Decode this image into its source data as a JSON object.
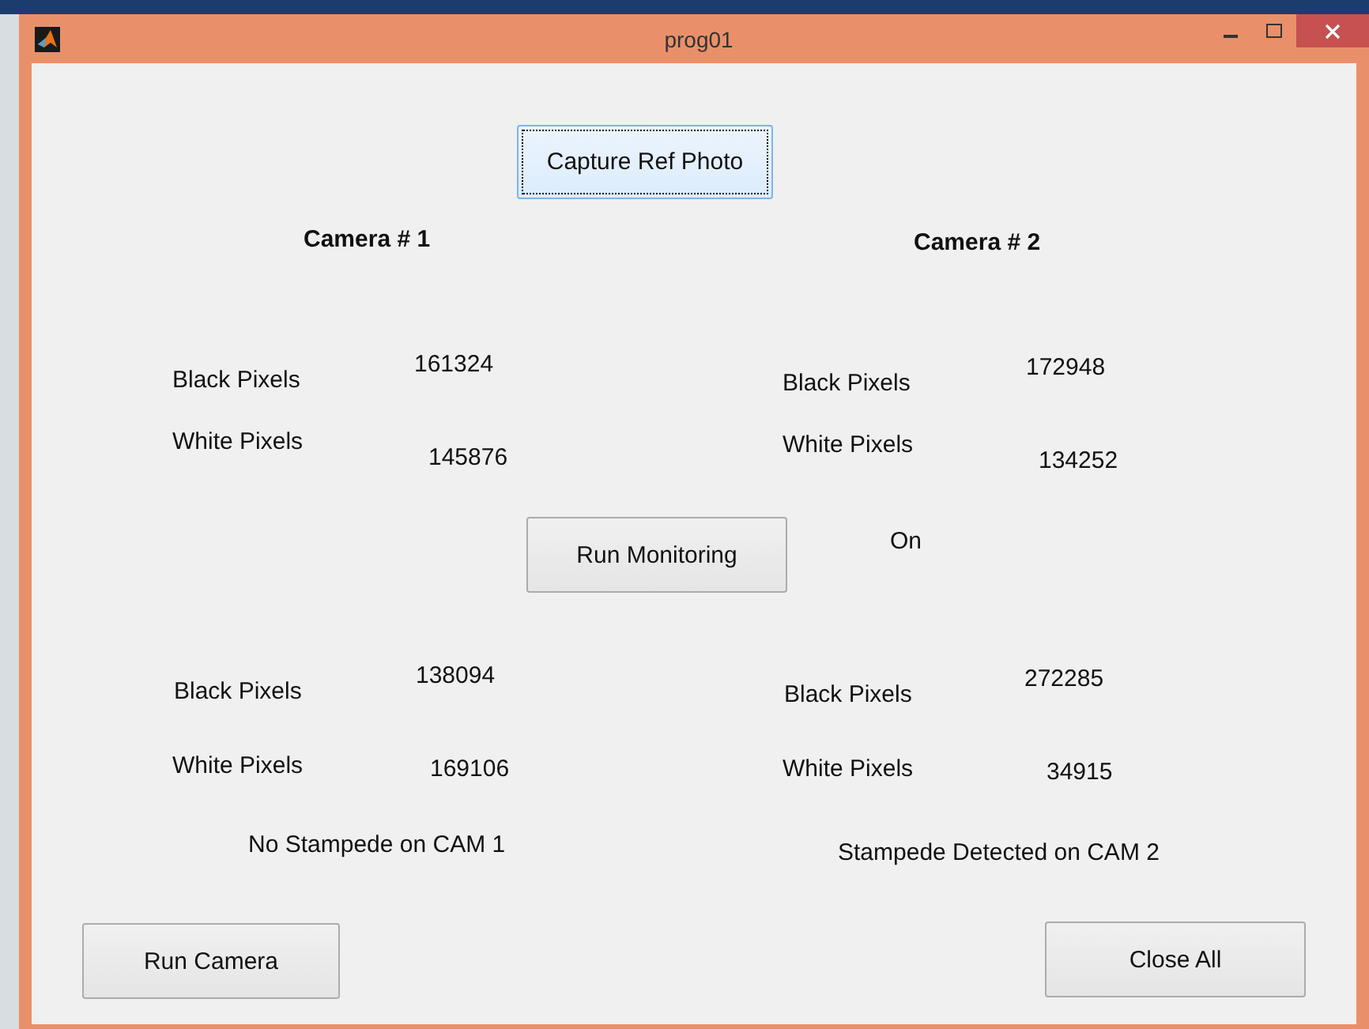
{
  "window": {
    "title": "prog01"
  },
  "capture_button": {
    "label": "Capture Ref Photo",
    "focused": true
  },
  "cameras": [
    {
      "heading": "Camera # 1",
      "reference": {
        "black_label": "Black Pixels",
        "black_value": "161324",
        "white_label": "White Pixels",
        "white_value": "145876"
      },
      "monitoring": {
        "black_label": "Black Pixels",
        "black_value": "138094",
        "white_label": "White Pixels",
        "white_value": "169106"
      },
      "status": "No Stampede on CAM 1"
    },
    {
      "heading": "Camera # 2",
      "reference": {
        "black_label": "Black Pixels",
        "black_value": "172948",
        "white_label": "White Pixels",
        "white_value": "134252"
      },
      "monitoring": {
        "black_label": "Black Pixels",
        "black_value": "272285",
        "white_label": "White Pixels",
        "white_value": "34915"
      },
      "status": "Stampede Detected on CAM 2"
    }
  ],
  "run_monitoring_button": {
    "label": "Run Monitoring"
  },
  "monitoring_state": "On",
  "run_camera_button": {
    "label": "Run Camera"
  },
  "close_all_button": {
    "label": "Close All"
  }
}
